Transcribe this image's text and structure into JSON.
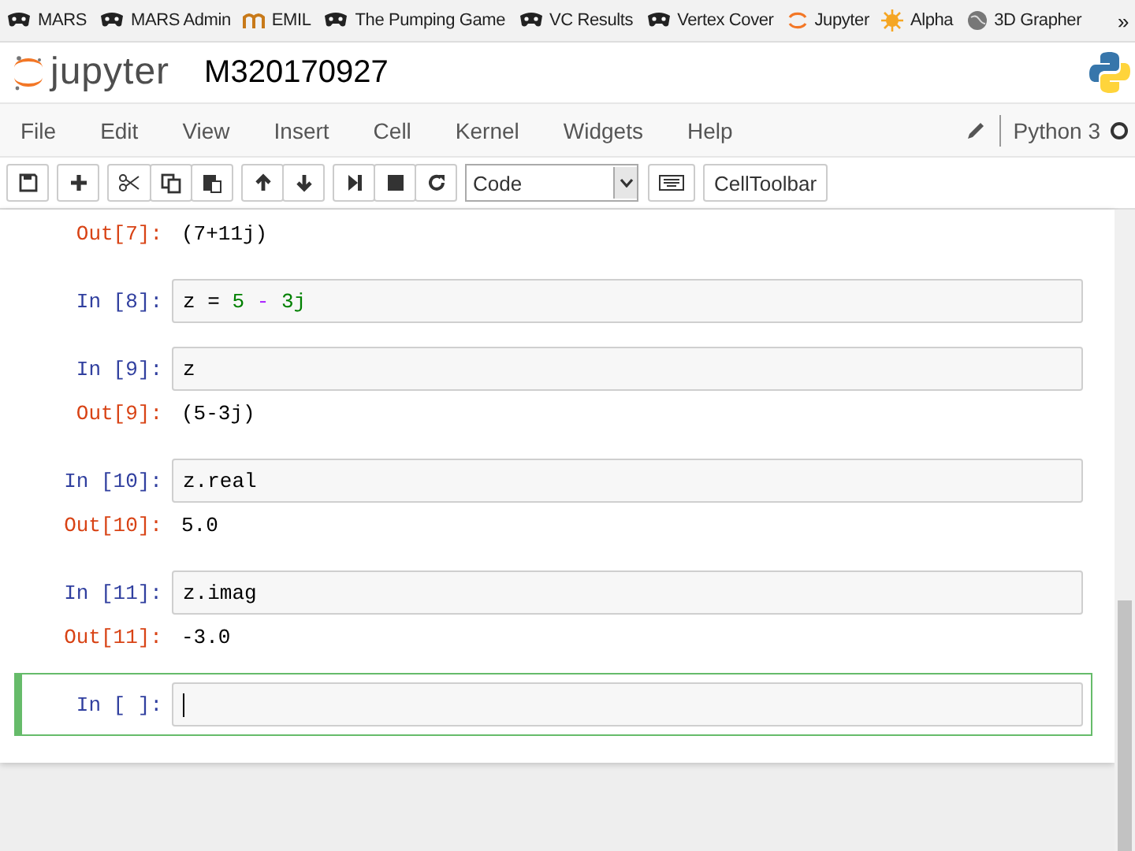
{
  "bookmarks": [
    {
      "label": "MARS",
      "kind": "mask"
    },
    {
      "label": "MARS Admin",
      "kind": "mask"
    },
    {
      "label": "EMIL",
      "kind": "letter"
    },
    {
      "label": "The Pumping Game",
      "kind": "mask"
    },
    {
      "label": "VC Results",
      "kind": "mask"
    },
    {
      "label": "Vertex Cover",
      "kind": "mask"
    },
    {
      "label": "Jupyter",
      "kind": "ring"
    },
    {
      "label": "Alpha",
      "kind": "sun"
    },
    {
      "label": "3D Grapher",
      "kind": "globe"
    }
  ],
  "bookmarks_more": "»",
  "header": {
    "app_name": "jupyter",
    "notebook_title": "M320170927"
  },
  "menu": [
    "File",
    "Edit",
    "View",
    "Insert",
    "Cell",
    "Kernel",
    "Widgets",
    "Help"
  ],
  "kernel": {
    "name": "Python 3",
    "busy": false
  },
  "toolbar": {
    "cell_type": "Code",
    "celltoolbar_label": "CellToolbar"
  },
  "cells": [
    {
      "out_prompt": "Out[7]:",
      "output": "(7+11j)",
      "selected": false
    },
    {
      "prompt": "In [8]:",
      "code": [
        {
          "text": "z = ",
          "kind": "plain"
        },
        {
          "text": "5 ",
          "kind": "number"
        },
        {
          "text": "- ",
          "kind": "op"
        },
        {
          "text": "3j",
          "kind": "number"
        }
      ],
      "selected": false
    },
    {
      "prompt": "In [9]:",
      "code": [
        {
          "text": "z",
          "kind": "plain"
        }
      ],
      "out_prompt": "Out[9]:",
      "output": "(5-3j)",
      "selected": false
    },
    {
      "prompt": "In [10]:",
      "code": [
        {
          "text": "z.real",
          "kind": "plain"
        }
      ],
      "out_prompt": "Out[10]:",
      "output": "5.0",
      "selected": false
    },
    {
      "prompt": "In [11]:",
      "code": [
        {
          "text": "z.imag",
          "kind": "plain"
        }
      ],
      "out_prompt": "Out[11]:",
      "output": "-3.0",
      "selected": false
    },
    {
      "prompt": "In [ ]:",
      "selected": true
    }
  ]
}
